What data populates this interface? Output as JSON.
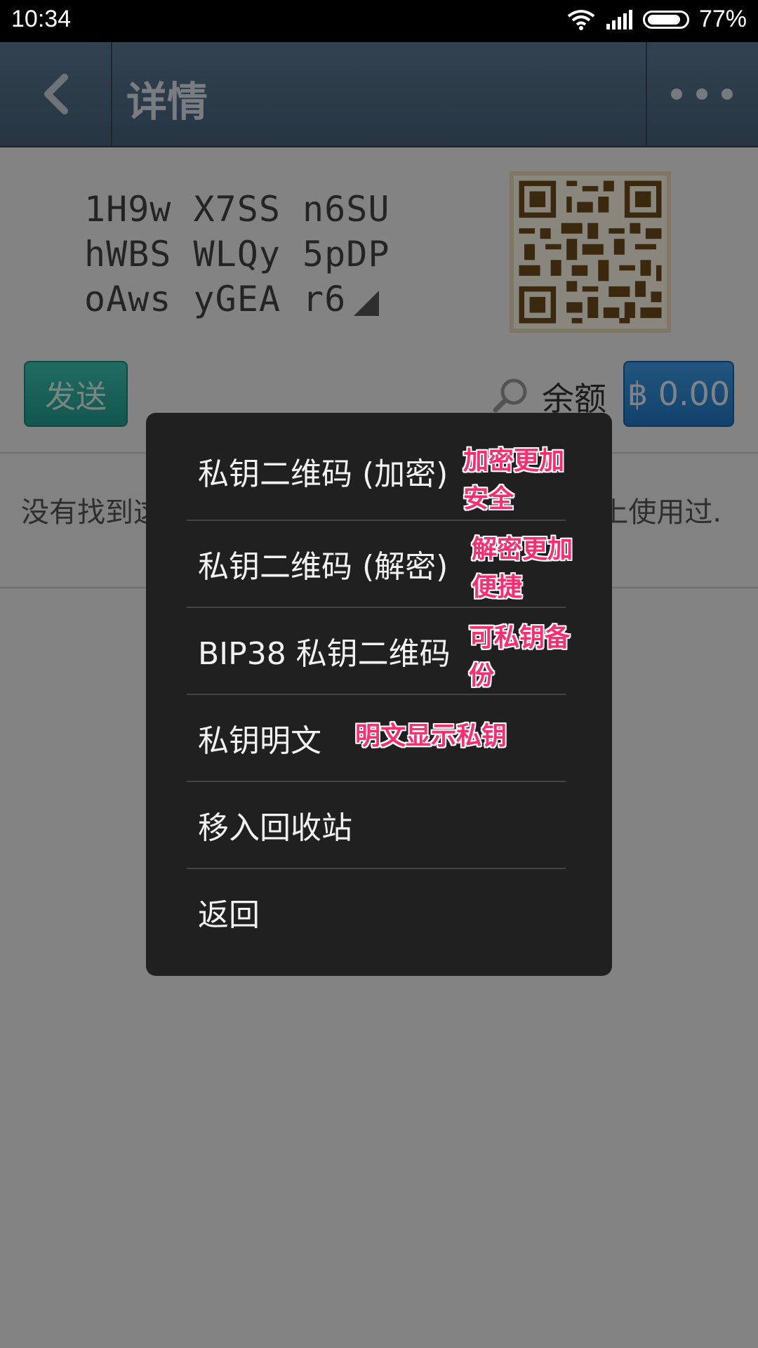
{
  "status_bar": {
    "time": "10:34",
    "battery": "77%"
  },
  "app_bar": {
    "title": "详情"
  },
  "address": {
    "line1": "1H9w X7SS n6SU",
    "line2": "hWBS WLQy 5pDP",
    "line3": "oAws yGEA r6"
  },
  "actions": {
    "send_label": "发送",
    "balance_label": "余额",
    "balance_value": "฿ 0.00"
  },
  "empty_message": "没有找到这个地址的交易, 它可能还没有在网络上使用过.",
  "menu": {
    "items": [
      {
        "label": "私钥二维码 (加密)"
      },
      {
        "label": "私钥二维码 (解密)"
      },
      {
        "label": "BIP38 私钥二维码"
      },
      {
        "label": "私钥明文"
      },
      {
        "label": "移入回收站"
      },
      {
        "label": "返回"
      }
    ]
  },
  "annotations": {
    "a1_line1": "加密更加",
    "a1_line2": "安全",
    "a2_line1": "解密更加",
    "a2_line2": "便捷",
    "a3_line1": "可私钥备",
    "a3_line2": "份",
    "a4": "明文显示私钥"
  },
  "colors": {
    "annotation": "#ff2d6f",
    "menu_bg": "#202020",
    "app_bar": "#506b85"
  }
}
